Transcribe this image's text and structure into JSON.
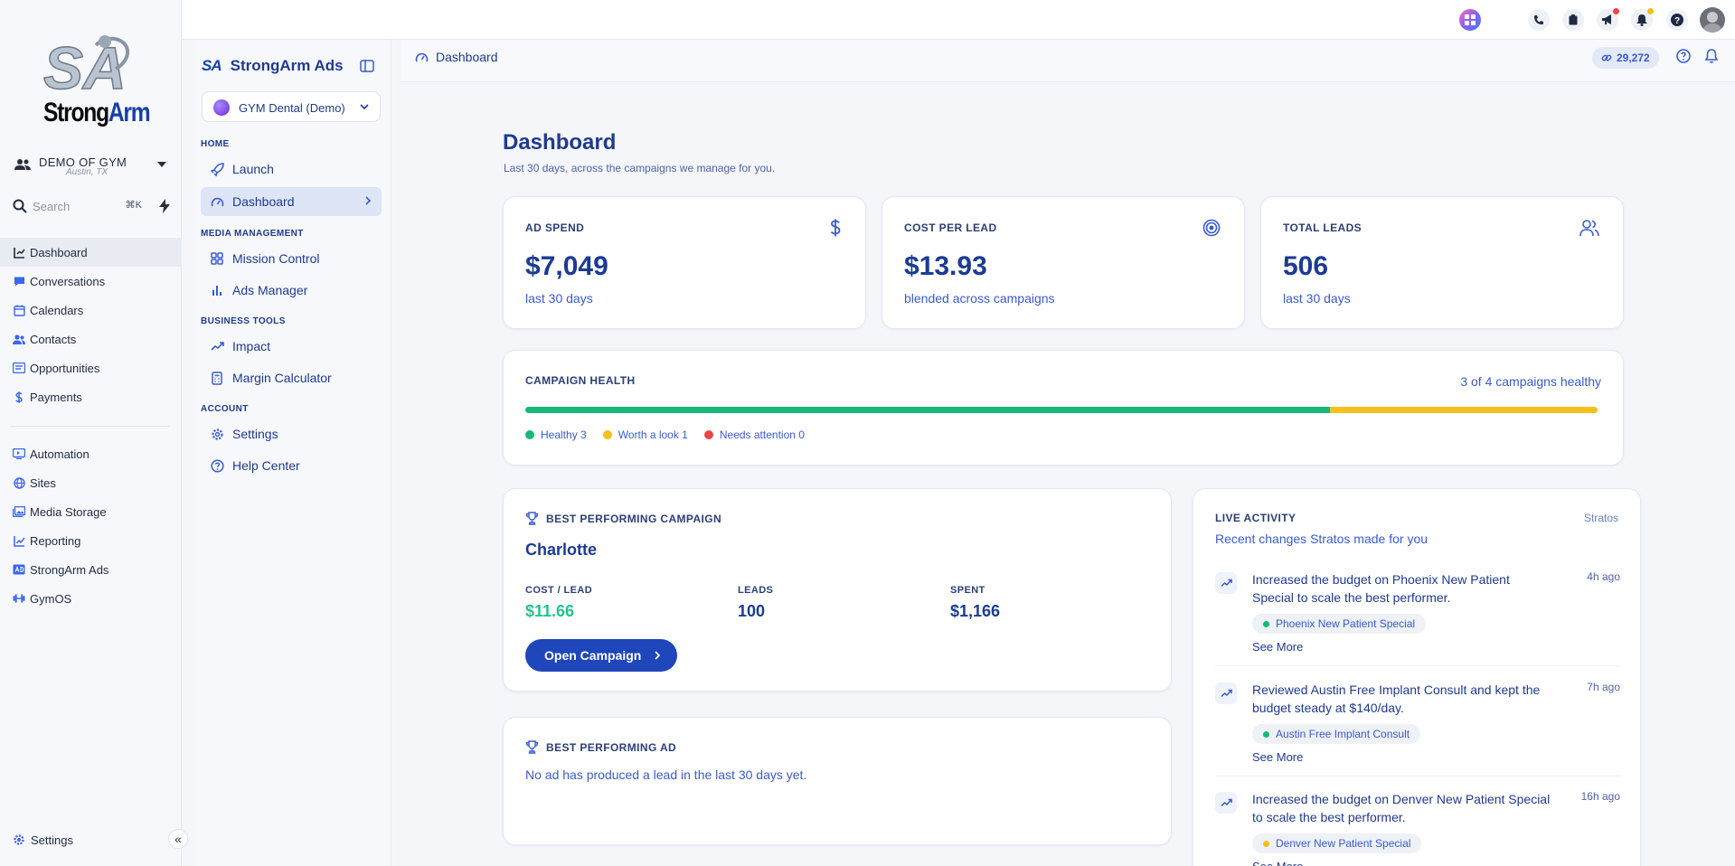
{
  "crm": {
    "logo": {
      "letters": "SA",
      "word_a": "Strong",
      "word_b": "Arm"
    },
    "location": {
      "name": "DEMO OF GYM",
      "city": "Austin, TX"
    },
    "search": {
      "placeholder": "Search",
      "shortcut": "⌘K"
    },
    "nav_primary": [
      {
        "label": "Dashboard",
        "icon": "dashboard-icon",
        "active": true
      },
      {
        "label": "Conversations",
        "icon": "chat-icon"
      },
      {
        "label": "Calendars",
        "icon": "calendar-icon"
      },
      {
        "label": "Contacts",
        "icon": "contacts-icon"
      },
      {
        "label": "Opportunities",
        "icon": "opportunities-icon"
      },
      {
        "label": "Payments",
        "icon": "dollar-icon"
      }
    ],
    "nav_secondary": [
      {
        "label": "Automation",
        "icon": "automation-icon"
      },
      {
        "label": "Sites",
        "icon": "globe-icon"
      },
      {
        "label": "Media Storage",
        "icon": "media-icon"
      },
      {
        "label": "Reporting",
        "icon": "reporting-icon"
      },
      {
        "label": "StrongArm Ads",
        "icon": "ads-icon"
      },
      {
        "label": "GymOS",
        "icon": "gymos-icon"
      }
    ],
    "settings_label": "Settings",
    "collapse_glyph": "«"
  },
  "topbar": {
    "icons": [
      "apps-icon",
      "phone-icon",
      "clipboard-icon",
      "megaphone-icon",
      "bell-icon",
      "help-icon",
      "avatar"
    ]
  },
  "app": {
    "brand_mark": "SA",
    "brand_name": "StrongArm Ads",
    "account": "GYM Dental (Demo)",
    "sections": {
      "home": "HOME",
      "media": "MEDIA MANAGEMENT",
      "business": "BUSINESS TOOLS",
      "account": "ACCOUNT"
    },
    "items": {
      "launch": "Launch",
      "dashboard": "Dashboard",
      "mission": "Mission Control",
      "ads": "Ads Manager",
      "impact": "Impact",
      "margin": "Margin Calculator",
      "settings": "Settings",
      "help": "Help Center"
    }
  },
  "main": {
    "breadcrumb": "Dashboard",
    "credits": "29,272",
    "title": "Dashboard",
    "subtitle": "Last 30 days, across the campaigns we manage for you.",
    "stats": [
      {
        "label": "AD SPEND",
        "value": "$7,049",
        "note": "last 30 days",
        "icon": "dollar-icon"
      },
      {
        "label": "COST PER LEAD",
        "value": "$13.93",
        "note": "blended across campaigns",
        "icon": "target-icon"
      },
      {
        "label": "TOTAL LEADS",
        "value": "506",
        "note": "last 30 days",
        "icon": "users-icon"
      }
    ],
    "health": {
      "label": "CAMPAIGN HEALTH",
      "summary": "3 of 4 campaigns healthy",
      "healthy_fraction": 0.75,
      "worth_fraction": 0.25,
      "colors": {
        "healthy": "#16b979",
        "worth": "#f5c01d",
        "needs": "#ef4444"
      },
      "legend": {
        "healthy": "Healthy 3",
        "worth": "Worth a look 1",
        "needs": "Needs attention 0"
      }
    },
    "best_campaign": {
      "label": "BEST PERFORMING CAMPAIGN",
      "name": "Charlotte",
      "metrics": [
        {
          "k": "COST / LEAD",
          "v": "$11.66"
        },
        {
          "k": "LEADS",
          "v": "100"
        },
        {
          "k": "SPENT",
          "v": "$1,166"
        }
      ],
      "button": "Open Campaign"
    },
    "best_ad": {
      "label": "BEST PERFORMING AD",
      "message": "No ad has produced a lead in the last 30 days yet."
    },
    "live": {
      "label": "LIVE ACTIVITY",
      "source": "Stratos",
      "subtitle": "Recent changes Stratos made for you",
      "items": [
        {
          "text": "Increased the budget on Phoenix New Patient Special to scale the best performer.",
          "time": "4h ago",
          "tag": "Phoenix New Patient Special",
          "tag_color": "#16b979",
          "more": "See More"
        },
        {
          "text": "Reviewed Austin Free Implant Consult and kept the budget steady at $140/day.",
          "time": "7h ago",
          "tag": "Austin Free Implant Consult",
          "tag_color": "#16b979",
          "more": "See More"
        },
        {
          "text": "Increased the budget on Denver New Patient Special to scale the best performer.",
          "time": "16h ago",
          "tag": "Denver New Patient Special",
          "tag_color": "#f5c01d",
          "more": "See More"
        }
      ]
    }
  }
}
